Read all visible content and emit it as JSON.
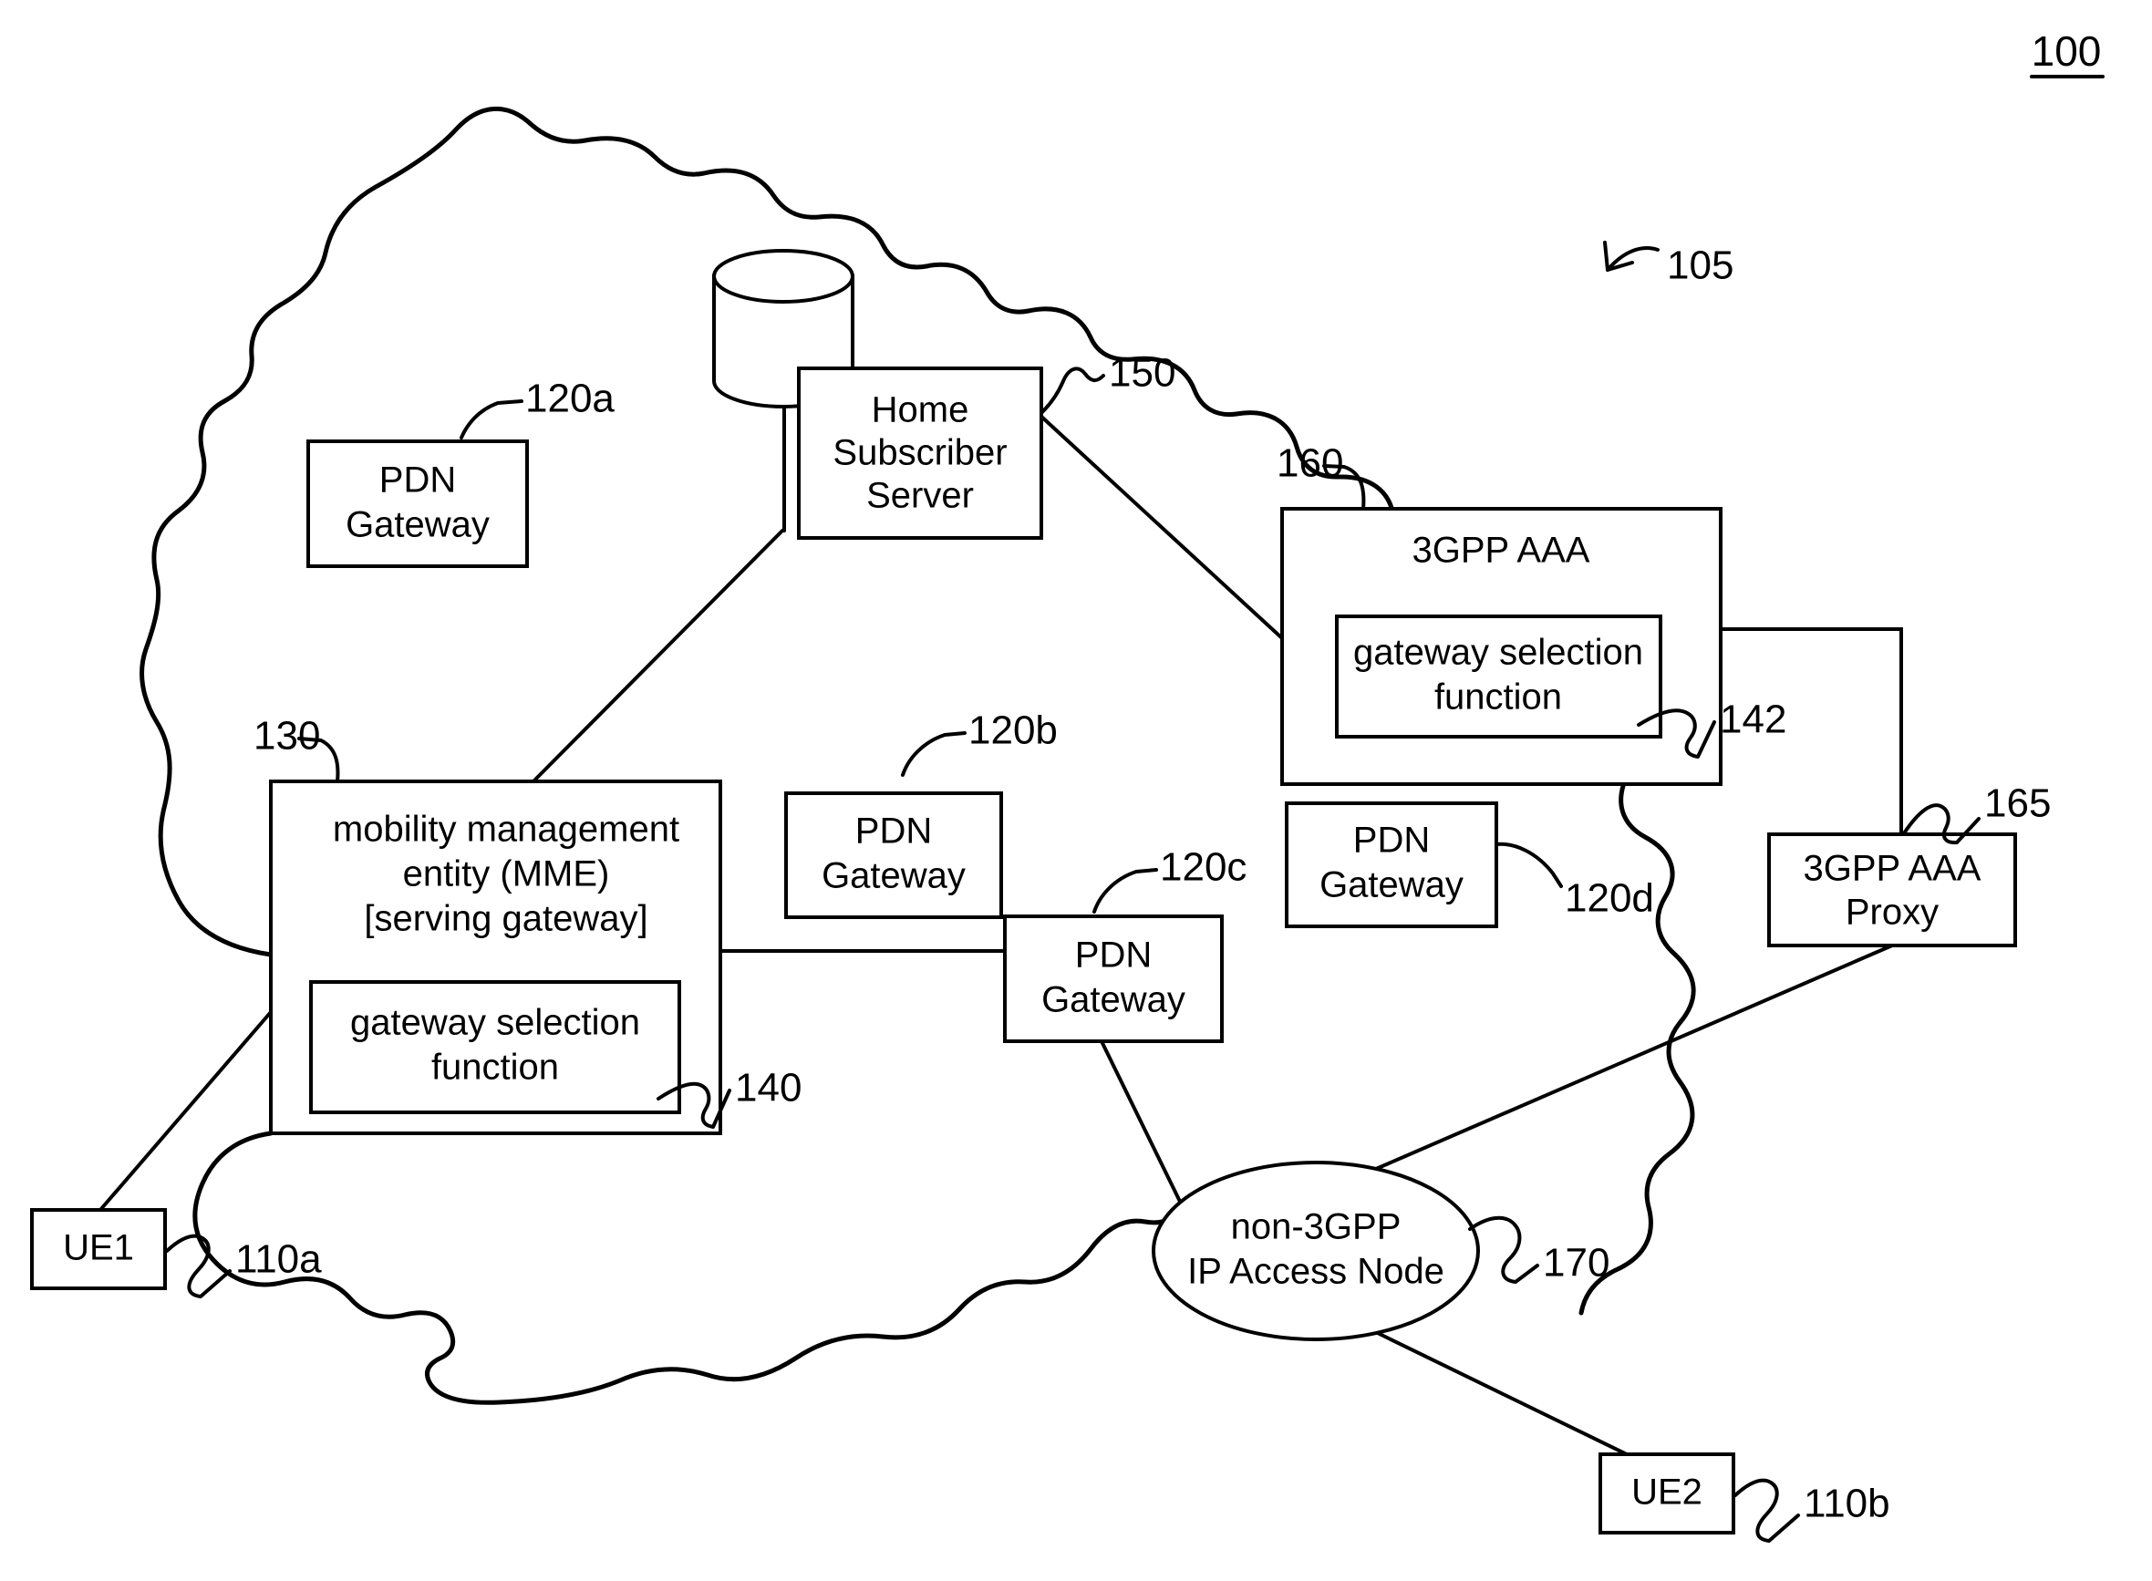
{
  "figure": {
    "number": "100",
    "number_underlined": true,
    "network_cloud_ref": "105"
  },
  "nodes": {
    "pdn_gateway_a": {
      "label_line1": "PDN",
      "label_line2": "Gateway",
      "ref": "120a"
    },
    "pdn_gateway_b": {
      "label_line1": "PDN",
      "label_line2": "Gateway",
      "ref": "120b"
    },
    "pdn_gateway_c": {
      "label_line1": "PDN",
      "label_line2": "Gateway",
      "ref": "120c"
    },
    "pdn_gateway_d": {
      "label_line1": "PDN",
      "label_line2": "Gateway",
      "ref": "120d"
    },
    "home_subscriber_server": {
      "label_line1": "Home",
      "label_line2": "Subscriber",
      "label_line3": "Server",
      "ref": "150"
    },
    "database_cylinder": {
      "icon": "database-cylinder-icon"
    },
    "mme": {
      "label_line1": "mobility management",
      "label_line2": "entity (MME)",
      "label_line3": "[serving gateway]",
      "ref": "130",
      "inner": {
        "label_line1": "gateway selection",
        "label_line2": "function",
        "ref": "140"
      }
    },
    "aaa": {
      "label": "3GPP AAA",
      "ref": "160",
      "inner": {
        "label_line1": "gateway selection",
        "label_line2": "function",
        "ref": "142"
      }
    },
    "aaa_proxy": {
      "label_line1": "3GPP AAA",
      "label_line2": "Proxy",
      "ref": "165"
    },
    "non_3gpp_access": {
      "label_line1": "non-3GPP",
      "label_line2": "IP Access Node",
      "ref": "170"
    },
    "ue1": {
      "label": "UE1",
      "ref": "110a"
    },
    "ue2": {
      "label": "UE2",
      "ref": "110b"
    }
  },
  "colors": {
    "stroke": "#000000",
    "fill": "#ffffff"
  }
}
